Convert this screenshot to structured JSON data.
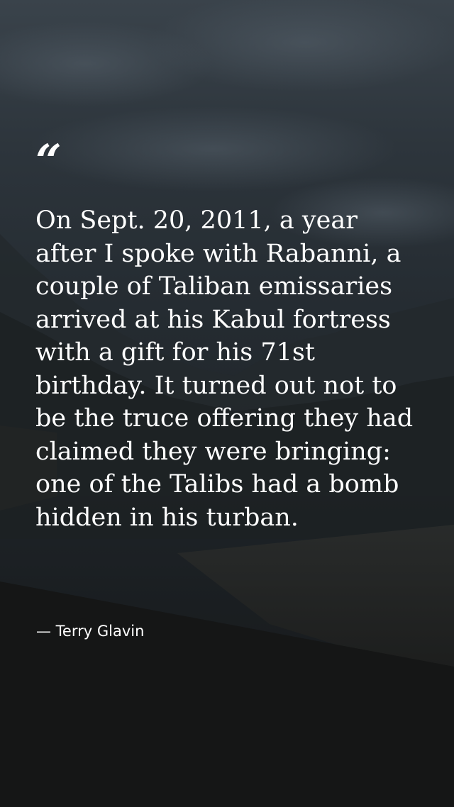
{
  "quote": {
    "mark": "“",
    "text": "On Sept. 20, 2011, a year after I spoke with Rabanni, a couple of Taliban emissaries arrived at his Kabul fortress with a gift for his 71st birthday. It turned out not to be the truce offering they had claimed they were bringing: one of the Talibs had a bomb hidden in his turban.",
    "attribution": "— Terry Glavin"
  },
  "colors": {
    "text": "#ffffff",
    "sky": "#2d353c",
    "ground": "#161819"
  }
}
